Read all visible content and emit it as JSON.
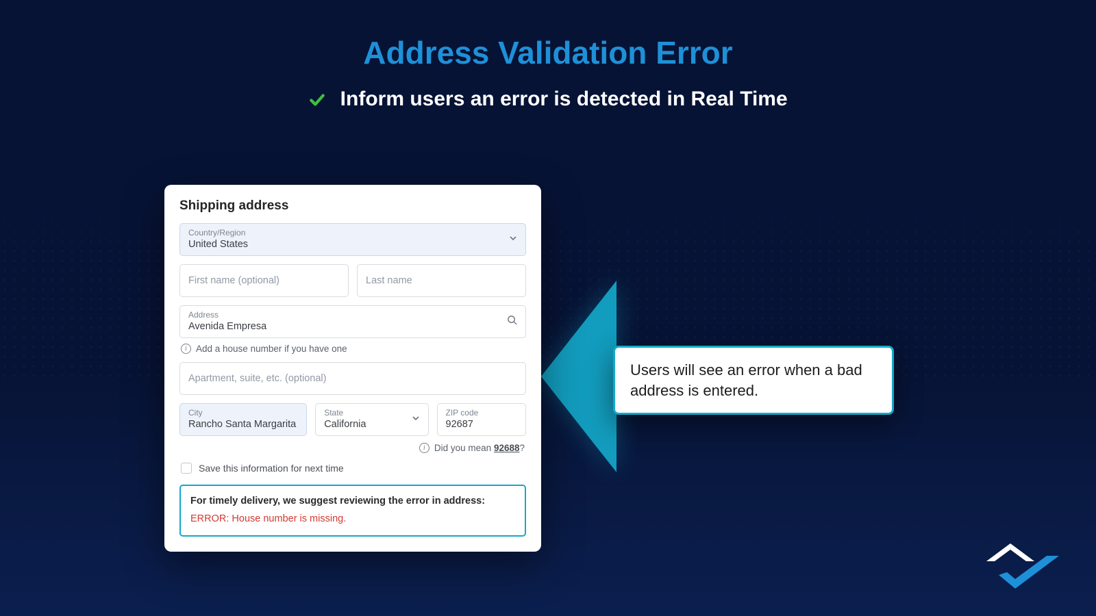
{
  "title": "Address Validation Error",
  "subtitle": "Inform users an error is detected in Real Time",
  "callout": "Users will see an error when a bad address is entered.",
  "form": {
    "heading": "Shipping address",
    "country": {
      "label": "Country/Region",
      "value": "United States"
    },
    "first_name_placeholder": "First name (optional)",
    "last_name_placeholder": "Last name",
    "address": {
      "label": "Address",
      "value": "Avenida Empresa"
    },
    "address_hint": "Add a house number if you have one",
    "apt_placeholder": "Apartment, suite, etc. (optional)",
    "city": {
      "label": "City",
      "value": "Rancho Santa Margarita"
    },
    "state": {
      "label": "State",
      "value": "California"
    },
    "zip": {
      "label": "ZIP code",
      "value": "92687"
    },
    "zip_hint_prefix": "Did you mean ",
    "zip_hint_value": "92688",
    "zip_hint_suffix": "?",
    "save_label": "Save this information for next time",
    "error_heading": "For timely delivery, we suggest reviewing the error in address:",
    "error_text": "ERROR: House number is missing."
  },
  "colors": {
    "accent": "#14a8c9",
    "title": "#1e90d8",
    "error": "#d33a32"
  }
}
